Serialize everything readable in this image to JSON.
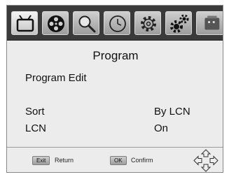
{
  "icons": [
    "tv-icon",
    "film-reel-icon",
    "search-icon",
    "clock-icon",
    "gear-icon",
    "gears-icon",
    "usb-icon"
  ],
  "menu": {
    "title": "Program",
    "items": [
      {
        "label": "Program Edit",
        "value": ""
      },
      {
        "label": "Sort",
        "value": "By LCN"
      },
      {
        "label": "LCN",
        "value": "On"
      }
    ]
  },
  "footer": {
    "exit_key": "Exit",
    "exit_label": "Return",
    "ok_key": "OK",
    "ok_label": "Confirm"
  },
  "colors": {
    "icon_bar": "#3a3a3a",
    "menu_background": "#ececec"
  }
}
